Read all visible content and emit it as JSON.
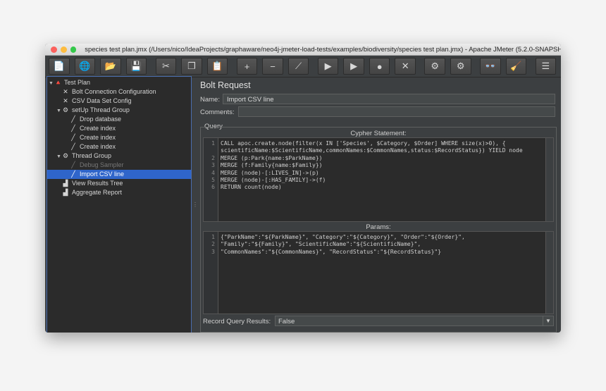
{
  "window": {
    "title": "species test plan.jmx (/Users/nico/IdeaProjects/graphaware/neo4j-jmeter-load-tests/examples/biodiversity/species test plan.jmx) - Apache JMeter (5.2.0-SNAPSHO..."
  },
  "toolbar": {
    "buttons": [
      {
        "icon": "new-icon",
        "glyph": "📄"
      },
      {
        "icon": "templates-icon",
        "glyph": "🌐"
      },
      {
        "icon": "open-icon",
        "glyph": "📂"
      },
      {
        "icon": "save-icon",
        "glyph": "💾"
      },
      {
        "icon": "cut-icon",
        "glyph": "✂"
      },
      {
        "icon": "copy-icon",
        "glyph": "❐"
      },
      {
        "icon": "paste-icon",
        "glyph": "📋"
      },
      {
        "icon": "expand-icon",
        "glyph": "+"
      },
      {
        "icon": "collapse-icon",
        "glyph": "−"
      },
      {
        "icon": "toggle-icon",
        "glyph": "⟋"
      },
      {
        "icon": "start-icon",
        "glyph": "▶"
      },
      {
        "icon": "start-no-pause-icon",
        "glyph": "▶"
      },
      {
        "icon": "stop-icon",
        "glyph": "●"
      },
      {
        "icon": "shutdown-icon",
        "glyph": "✕"
      },
      {
        "icon": "clear-icon",
        "glyph": "⚙"
      },
      {
        "icon": "clear-all-icon",
        "glyph": "⚙"
      },
      {
        "icon": "search-icon",
        "glyph": "👓"
      },
      {
        "icon": "reset-search-icon",
        "glyph": "🧹"
      },
      {
        "icon": "function-helper-icon",
        "glyph": "☰"
      }
    ]
  },
  "tree": {
    "items": [
      {
        "label": "Test Plan",
        "indent": 0,
        "toggle": "▼",
        "glyph": "🔺",
        "icon": "test-plan-icon",
        "selected": false,
        "disabled": false
      },
      {
        "label": "Bolt Connection Configuration",
        "indent": 1,
        "toggle": "",
        "glyph": "✕",
        "icon": "config-element-icon",
        "selected": false,
        "disabled": false
      },
      {
        "label": "CSV Data Set Config",
        "indent": 1,
        "toggle": "",
        "glyph": "✕",
        "icon": "config-element-icon",
        "selected": false,
        "disabled": false
      },
      {
        "label": "setUp Thread Group",
        "indent": 1,
        "toggle": "▼",
        "glyph": "⚙",
        "icon": "thread-group-icon",
        "selected": false,
        "disabled": false
      },
      {
        "label": "Drop database",
        "indent": 2,
        "toggle": "",
        "glyph": "╱",
        "icon": "sampler-icon",
        "selected": false,
        "disabled": false
      },
      {
        "label": "Create index",
        "indent": 2,
        "toggle": "",
        "glyph": "╱",
        "icon": "sampler-icon",
        "selected": false,
        "disabled": false
      },
      {
        "label": "Create index",
        "indent": 2,
        "toggle": "",
        "glyph": "╱",
        "icon": "sampler-icon",
        "selected": false,
        "disabled": false
      },
      {
        "label": "Create index",
        "indent": 2,
        "toggle": "",
        "glyph": "╱",
        "icon": "sampler-icon",
        "selected": false,
        "disabled": false
      },
      {
        "label": "Thread Group",
        "indent": 1,
        "toggle": "▼",
        "glyph": "⚙",
        "icon": "thread-group-icon",
        "selected": false,
        "disabled": false
      },
      {
        "label": "Debug Sampler",
        "indent": 2,
        "toggle": "",
        "glyph": "╱",
        "icon": "sampler-icon",
        "selected": false,
        "disabled": true
      },
      {
        "label": "Import CSV line",
        "indent": 2,
        "toggle": "",
        "glyph": "╱",
        "icon": "sampler-icon",
        "selected": true,
        "disabled": false
      },
      {
        "label": "View Results Tree",
        "indent": 1,
        "toggle": "",
        "glyph": "▟",
        "icon": "listener-icon",
        "selected": false,
        "disabled": false
      },
      {
        "label": "Aggregate Report",
        "indent": 1,
        "toggle": "",
        "glyph": "▟",
        "icon": "listener-icon",
        "selected": false,
        "disabled": false
      }
    ]
  },
  "panel": {
    "title": "Bolt Request",
    "name_label": "Name:",
    "name_value": "Import CSV line",
    "comments_label": "Comments:",
    "comments_value": "",
    "query_label": "Query",
    "cypher_header": "Cypher Statement:",
    "params_header": "Params:",
    "record_label": "Record Query Results:",
    "record_value": "False"
  },
  "cypher_lines": [
    {
      "n": "1",
      "text": "CALL apoc.create.node(filter(x IN ['Species', $Category, $Order] WHERE size(x)>0), {"
    },
    {
      "n": "",
      "text": "scientificName:$ScientificName,commonNames:$CommonNames,status:$RecordStatus}) YIELD node"
    },
    {
      "n": "2",
      "text": "MERGE (p:Park{name:$ParkName})"
    },
    {
      "n": "3",
      "text": "MERGE (f:Family{name:$Family})"
    },
    {
      "n": "4",
      "text": "MERGE (node)-[:LIVES_IN]->(p)"
    },
    {
      "n": "5",
      "text": "MERGE (node)-[:HAS_FAMILY]->(f)"
    },
    {
      "n": "6",
      "text": "RETURN count(node)"
    }
  ],
  "params_lines": [
    {
      "n": "1",
      "text": "{\"ParkName\":\"${ParkName}\", \"Category\":\"${Category}\", \"Order\":\"${Order}\","
    },
    {
      "n": "2",
      "text": "\"Family\":\"${Family}\", \"ScientificName\":\"${ScientificName}\","
    },
    {
      "n": "3",
      "text": "\"CommonNames\":\"${CommonNames}\", \"RecordStatus\":\"${RecordStatus}\"}"
    }
  ]
}
